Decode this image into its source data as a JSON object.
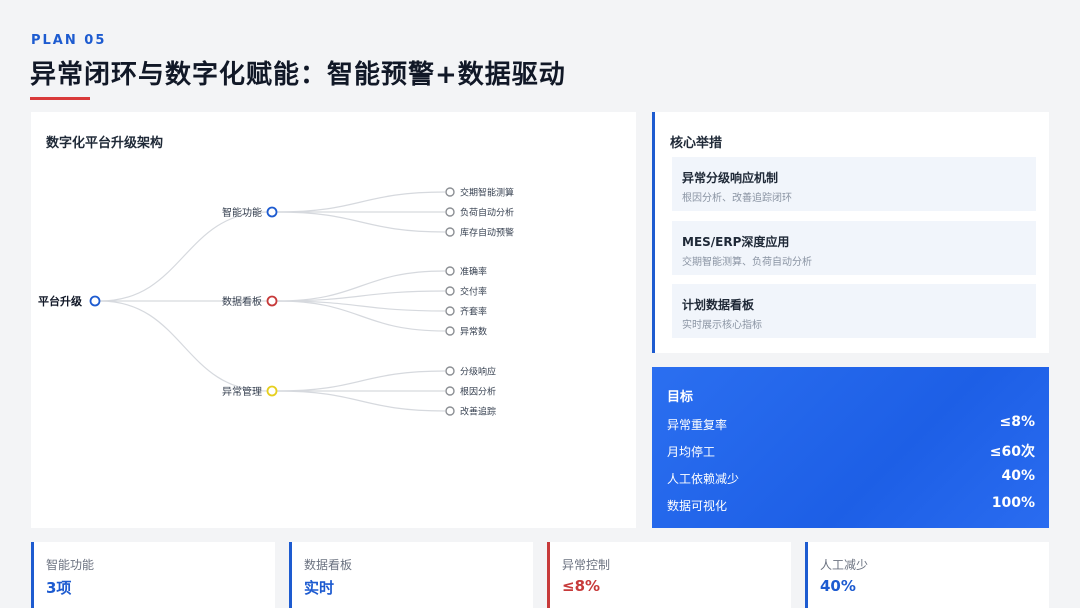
{
  "header": {
    "plan_label": "PLAN 05",
    "title": "异常闭环与数字化赋能：智能预警+数据驱动"
  },
  "architecture": {
    "title": "数字化平台升级架构",
    "root": {
      "label": "平台升级",
      "color": "#1d5bd0"
    },
    "branches": [
      {
        "label": "智能功能",
        "color": "#1d5bd0",
        "leaves": [
          "交期智能测算",
          "负荷自动分析",
          "库存自动预警"
        ]
      },
      {
        "label": "数据看板",
        "color": "#c73a3a",
        "leaves": [
          "准确率",
          "交付率",
          "齐套率",
          "异常数"
        ]
      },
      {
        "label": "异常管理",
        "color": "#e6cf1e",
        "leaves": [
          "分级响应",
          "根因分析",
          "改善追踪"
        ]
      }
    ]
  },
  "measures": {
    "title": "核心举措",
    "items": [
      {
        "title": "异常分级响应机制",
        "subtitle": "根因分析、改善追踪闭环"
      },
      {
        "title": "MES/ERP深度应用",
        "subtitle": "交期智能测算、负荷自动分析"
      },
      {
        "title": "计划数据看板",
        "subtitle": "实时展示核心指标"
      }
    ]
  },
  "goals": {
    "title": "目标",
    "rows": [
      {
        "label": "异常重复率",
        "value": "≤8%"
      },
      {
        "label": "月均停工",
        "value": "≤60次"
      },
      {
        "label": "人工依赖减少",
        "value": "40%"
      },
      {
        "label": "数据可视化",
        "value": "100%"
      }
    ]
  },
  "stats": [
    {
      "label": "智能功能",
      "value": "3项",
      "accent": "#1d5bd0"
    },
    {
      "label": "数据看板",
      "value": "实时",
      "accent": "#1d5bd0"
    },
    {
      "label": "异常控制",
      "value": "≤8%",
      "accent": "#c73a3a"
    },
    {
      "label": "人工减少",
      "value": "40%",
      "accent": "#1d5bd0"
    }
  ],
  "colors": {
    "accent_blue": "#1d5bd0",
    "accent_red": "#c73a3a",
    "accent_yellow": "#e6cf1e",
    "title_underline": "#d93a3a"
  }
}
